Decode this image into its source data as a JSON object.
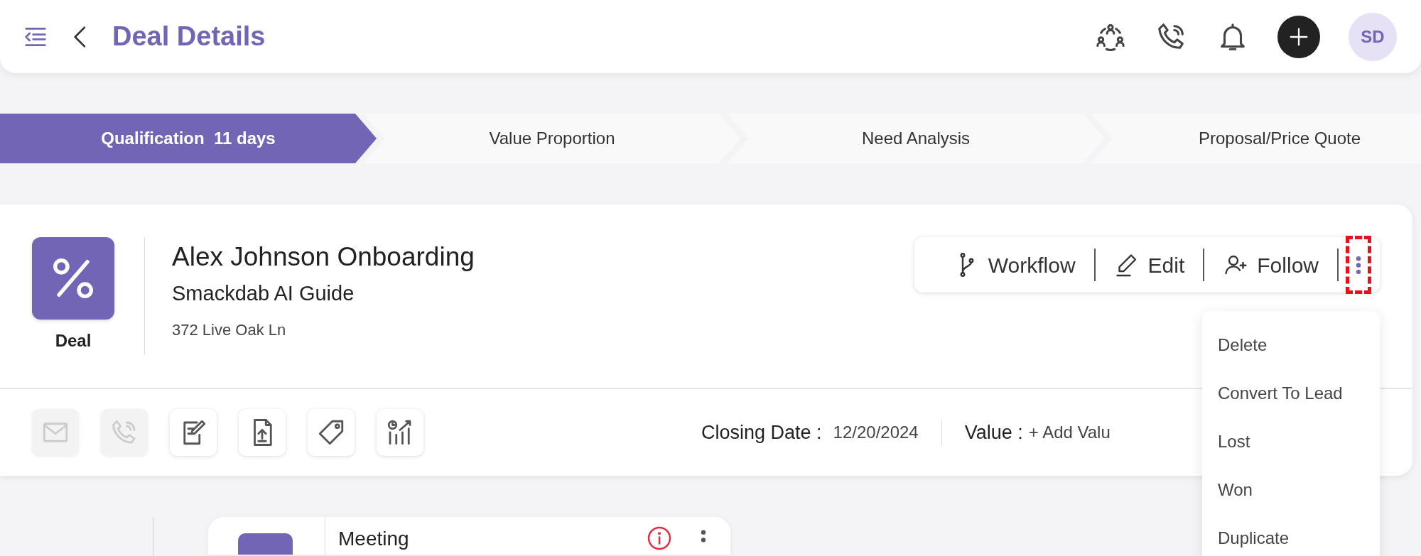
{
  "header": {
    "title": "Deal Details",
    "avatar": "SD"
  },
  "stages": [
    {
      "label": "Qualification",
      "duration": "11 days",
      "selected": true
    },
    {
      "label": "Value Proportion",
      "selected": false
    },
    {
      "label": "Need Analysis",
      "selected": false
    },
    {
      "label": "Proposal/Price Quote",
      "selected": false
    }
  ],
  "deal": {
    "type_label": "Deal",
    "name": "Alex Johnson Onboarding",
    "company": "Smackdab AI Guide",
    "address": "372 Live Oak Ln"
  },
  "actions": [
    {
      "label": "Workflow",
      "kind": "workflow"
    },
    {
      "label": "Edit",
      "kind": "edit"
    },
    {
      "label": "Follow",
      "kind": "follow"
    }
  ],
  "more_button": {
    "highlighted": true
  },
  "menu": {
    "items": [
      "Delete",
      "Convert To Lead",
      "Lost",
      "Won",
      "Duplicate"
    ]
  },
  "quick_actions": [
    {
      "kind": "email",
      "disabled": true
    },
    {
      "kind": "call",
      "disabled": true
    },
    {
      "kind": "note",
      "disabled": false
    },
    {
      "kind": "upload",
      "disabled": false
    },
    {
      "kind": "tag",
      "disabled": false
    },
    {
      "kind": "report",
      "disabled": false
    }
  ],
  "closing_date": {
    "label": "Closing Date :",
    "value": "12/20/2024"
  },
  "value": {
    "label": "Value :",
    "action": "+ Add Valu"
  },
  "activities": [
    {
      "title": "Meeting",
      "alert": true
    }
  ]
}
